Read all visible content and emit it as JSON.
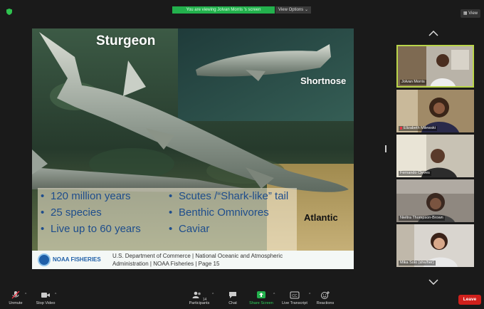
{
  "banner": {
    "viewing_text": "You are viewing Jolvan Morris 's screen",
    "view_options": "View Options ⌄",
    "view_button": "View"
  },
  "slide": {
    "title": "Sturgeon",
    "label_shortnose": "Shortnose",
    "label_atlantic": "Atlantic",
    "bullets_left": [
      "120 million years",
      "25 species",
      "Live up to 60 years"
    ],
    "bullets_right": [
      "Scutes /“Shark-like” tail",
      "Benthic Omnivores",
      "Caviar"
    ],
    "noaa_word": "NOAA FISHERIES",
    "footer_line1": "U.S. Department of Commerce  |  National Oceanic and Atmospheric",
    "footer_line2": "Administration  |  NOAA Fisheries  |  Page 15"
  },
  "participants": [
    {
      "name": "Jolvan Morris",
      "active": true,
      "muted": false
    },
    {
      "name": "Elizabeth Milewski",
      "active": false,
      "muted": true
    },
    {
      "name": "Fernando Cleves",
      "active": false,
      "muted": false
    },
    {
      "name": "Nieltra Thompson-Brown",
      "active": false,
      "muted": false
    },
    {
      "name": "Mika Solo (she/her)",
      "active": false,
      "muted": false
    }
  ],
  "toolbar": {
    "unmute": "Unmute",
    "stop_video": "Stop Video",
    "participants": "Participants",
    "participants_count": "14",
    "chat": "Chat",
    "share_screen": "Share Screen",
    "live_transcript": "Live Transcript",
    "reactions": "Reactions",
    "leave": "Leave"
  },
  "colors": {
    "share_green": "#23b14d",
    "active_border": "#b9d54a",
    "leave_red": "#d0201c",
    "bullet_blue": "#1e4d8c"
  }
}
